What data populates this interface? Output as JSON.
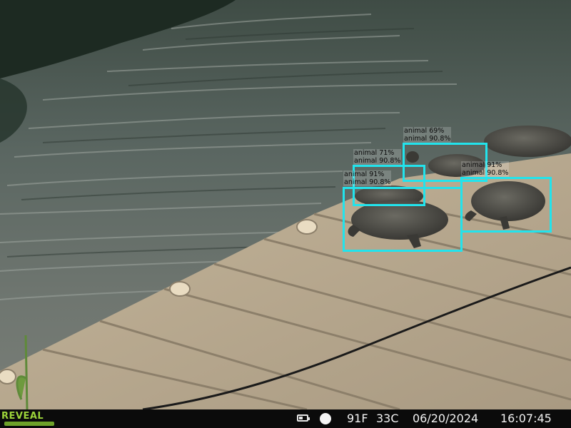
{
  "camera": {
    "brand": "REVEAL",
    "battery_level": 0.5,
    "moon_phase_icon": "full-moon-icon",
    "temp_f": "91F",
    "temp_c": "33C",
    "date": "06/20/2024",
    "time": "16:07:45"
  },
  "detections": [
    {
      "label": "animal 69%",
      "sublabel": "animal 90.8%"
    },
    {
      "label": "animal 71%",
      "sublabel": "animal 90.8%"
    },
    {
      "label": "animal 91%",
      "sublabel": "animal 90.8%"
    },
    {
      "label": "animal 91%",
      "sublabel": "animal 90.8%"
    }
  ],
  "colors": {
    "box": "#22e3ec",
    "status_bar": "#0b0b0b",
    "logo": "#9cd33a"
  }
}
